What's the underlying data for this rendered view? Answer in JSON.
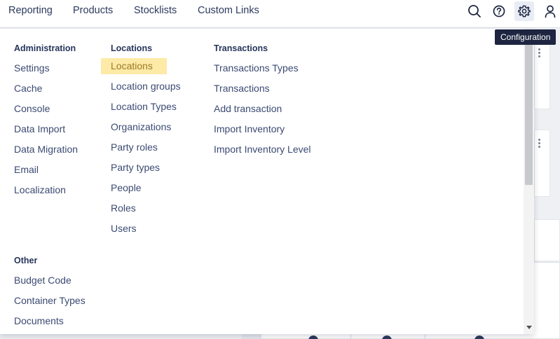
{
  "nav": {
    "items": [
      {
        "label": "Reporting"
      },
      {
        "label": "Products"
      },
      {
        "label": "Stocklists"
      },
      {
        "label": "Custom Links"
      }
    ]
  },
  "icons": {
    "search": "search-icon",
    "help": "help-icon",
    "settings": "gear-icon",
    "user": "user-icon"
  },
  "tooltip": {
    "text": "Configuration"
  },
  "menu": {
    "administration": {
      "heading": "Administration",
      "links": [
        "Settings",
        "Cache",
        "Console",
        "Data Import",
        "Data Migration",
        "Email",
        "Localization"
      ]
    },
    "other": {
      "heading": "Other",
      "links": [
        "Budget Code",
        "Container Types",
        "Documents"
      ]
    },
    "locations": {
      "heading": "Locations",
      "links": [
        "Locations",
        "Location groups",
        "Location Types",
        "Organizations",
        "Party roles",
        "Party types",
        "People",
        "Roles",
        "Users"
      ],
      "highlighted": "Locations"
    },
    "transactions": {
      "heading": "Transactions",
      "links": [
        "Transactions Types",
        "Transactions",
        "Add transaction",
        "Import Inventory",
        "Import Inventory Level"
      ]
    }
  },
  "colors": {
    "text": "#27355b",
    "highlight_bg": "#fdeaa6",
    "highlight_text": "#9b7a2a",
    "tooltip_bg": "#1d2540"
  }
}
